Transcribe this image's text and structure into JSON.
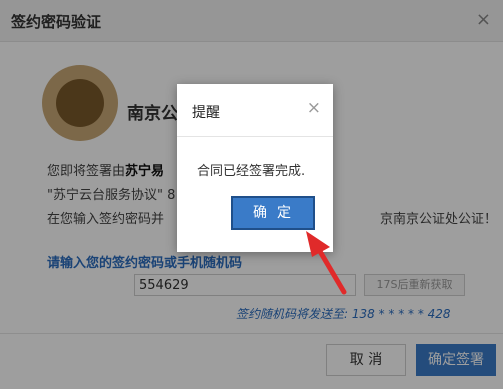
{
  "dialog": {
    "title": "签约密码验证",
    "close_icon": "close-icon",
    "org_name": "南京公",
    "line1_prefix": "您即将签署由",
    "line1_bold": "苏宁易",
    "line2": "\"苏宁云台服务协议\" 8",
    "line3_prefix": "在您输入签约密码并",
    "line3_suffix": "京南京公证处公证！",
    "password_label": "请输入您的签约密码或手机随机码",
    "password_value": "554629",
    "resend_label": "17S后重新获取",
    "sent_text": "签约随机码将发送至: 138 * * * * * 428",
    "cancel_label": "取 消",
    "confirm_label": "确定签署"
  },
  "alert": {
    "title": "提醒",
    "close_icon": "close-icon",
    "message": "合同已经签署完成.",
    "ok_label": "确定"
  },
  "colors": {
    "accent": "#3a7bc8",
    "link_blue": "#2a6cbf",
    "arrow_red": "#e02a2a",
    "seal_gold": "#c8a877"
  }
}
